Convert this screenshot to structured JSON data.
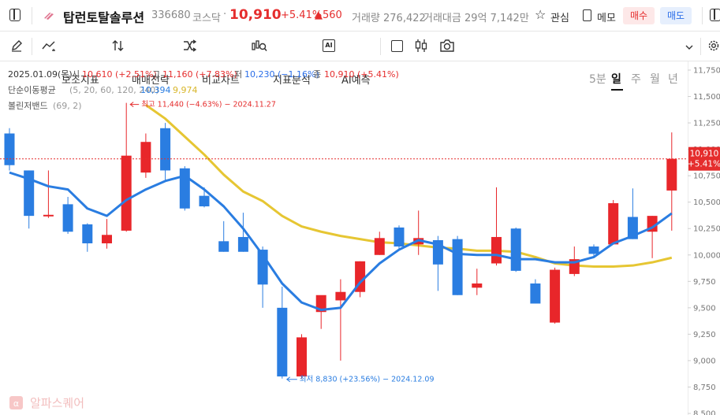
{
  "header": {
    "title": "탑런토탈솔루션",
    "code": "336680",
    "market": "코스닥",
    "dot": "·",
    "price": "10,910",
    "change_pct": "+5.41%",
    "change_amt": "▲560",
    "volume": "거래량 276,422",
    "amount": "거래대금 29억 7,142만",
    "watch_label": "관심",
    "memo_label": "메모",
    "buy_label": "매수",
    "sell_label": "매도"
  },
  "toolbar": {
    "indicator": "보조지표",
    "strategy": "매매전략",
    "compare": "비교차트",
    "analysis": "지표분석",
    "ai": "AI예측",
    "ai_badge": "AI",
    "periods": [
      "5분",
      "일",
      "주",
      "월",
      "년"
    ],
    "active_period": "일"
  },
  "legend": {
    "date": "2025.01.09(목)",
    "open_label": "시",
    "open": "10,610 (+2.51%)",
    "high_label": "고",
    "high": "11,160 (+7.83%)",
    "low_label": "저",
    "low": "10,230 (−1.16%)",
    "close_label": "종",
    "close": "10,910 (+5.41%)",
    "ma_label": "단순이동평균",
    "ma_params": "(5, 20, 60, 120, 240)",
    "ma5": "10,394",
    "ma20": "9,974",
    "bb_label": "볼린저밴드",
    "bb_params": "(69, 2)"
  },
  "annotations": {
    "max": "최고 11,440 (−4.63%) − 2024.11.27",
    "min": "최저 8,830 (+23.56%) − 2024.12.09"
  },
  "current_price_tag": {
    "price": "10,910",
    "pct": "+5.41%"
  },
  "watermark": "알파스퀘어",
  "colors": {
    "up": "#e8262a",
    "down": "#2a7de1",
    "ma5": "#2a7de1",
    "ma20": "#e6c633",
    "price_line": "#e52d2d"
  },
  "chart_data": {
    "type": "candlestick",
    "ylim": [
      8500,
      11750
    ],
    "y_ticks": [
      "11,750",
      "11,500",
      "11,250",
      "11,000",
      "10,750",
      "10,500",
      "10,250",
      "10,000",
      "9,750",
      "9,500",
      "9,250",
      "9,000",
      "8,750",
      "8,500"
    ],
    "candles": [
      {
        "o": 11150,
        "h": 11200,
        "l": 10800,
        "c": 10850
      },
      {
        "o": 10800,
        "h": 10800,
        "l": 10250,
        "c": 10370
      },
      {
        "o": 10370,
        "h": 10800,
        "l": 10350,
        "c": 10380
      },
      {
        "o": 10480,
        "h": 10550,
        "l": 10200,
        "c": 10220
      },
      {
        "o": 10290,
        "h": 10300,
        "l": 10030,
        "c": 10110
      },
      {
        "o": 10110,
        "h": 10340,
        "l": 10060,
        "c": 10190
      },
      {
        "o": 10230,
        "h": 11440,
        "l": 10220,
        "c": 10940
      },
      {
        "o": 10780,
        "h": 11150,
        "l": 10730,
        "c": 11070
      },
      {
        "o": 11200,
        "h": 11250,
        "l": 10700,
        "c": 10800
      },
      {
        "o": 10820,
        "h": 10840,
        "l": 10420,
        "c": 10440
      },
      {
        "o": 10560,
        "h": 10640,
        "l": 10450,
        "c": 10460
      },
      {
        "o": 10130,
        "h": 10320,
        "l": 10030,
        "c": 10030
      },
      {
        "o": 10170,
        "h": 10400,
        "l": 10030,
        "c": 10030
      },
      {
        "o": 10050,
        "h": 10080,
        "l": 9500,
        "c": 9720
      },
      {
        "o": 9500,
        "h": 9700,
        "l": 8830,
        "c": 8850
      },
      {
        "o": 8850,
        "h": 9250,
        "l": 8830,
        "c": 9220
      },
      {
        "o": 9460,
        "h": 9600,
        "l": 9300,
        "c": 9620
      },
      {
        "o": 9570,
        "h": 9770,
        "l": 9000,
        "c": 9650
      },
      {
        "o": 9650,
        "h": 9940,
        "l": 9600,
        "c": 9940
      },
      {
        "o": 10000,
        "h": 10220,
        "l": 10000,
        "c": 10160
      },
      {
        "o": 10260,
        "h": 10280,
        "l": 10060,
        "c": 10080
      },
      {
        "o": 10100,
        "h": 10420,
        "l": 10000,
        "c": 10160
      },
      {
        "o": 10140,
        "h": 10180,
        "l": 9660,
        "c": 9910
      },
      {
        "o": 10150,
        "h": 10180,
        "l": 9620,
        "c": 9620
      },
      {
        "o": 9690,
        "h": 9870,
        "l": 9620,
        "c": 9730
      },
      {
        "o": 9920,
        "h": 10640,
        "l": 9900,
        "c": 10170
      },
      {
        "o": 10250,
        "h": 10260,
        "l": 9840,
        "c": 9850
      },
      {
        "o": 9730,
        "h": 9770,
        "l": 9540,
        "c": 9540
      },
      {
        "o": 9360,
        "h": 9880,
        "l": 9350,
        "c": 9860
      },
      {
        "o": 9820,
        "h": 10080,
        "l": 9800,
        "c": 9960
      },
      {
        "o": 10080,
        "h": 10100,
        "l": 9990,
        "c": 10010
      },
      {
        "o": 10100,
        "h": 10520,
        "l": 10100,
        "c": 10490
      },
      {
        "o": 10360,
        "h": 10630,
        "l": 10150,
        "c": 10150
      },
      {
        "o": 10220,
        "h": 10370,
        "l": 9970,
        "c": 10370
      },
      {
        "o": 10610,
        "h": 11160,
        "l": 10230,
        "c": 10910
      }
    ],
    "ma5": [
      10780,
      10720,
      10650,
      10620,
      10440,
      10370,
      10520,
      10620,
      10700,
      10750,
      10620,
      10460,
      10250,
      10000,
      9730,
      9550,
      9480,
      9500,
      9740,
      9920,
      10050,
      10140,
      10100,
      10010,
      10000,
      10000,
      9960,
      9960,
      9930,
      9930,
      9980,
      10110,
      10180,
      10260,
      10394
    ],
    "ma20": [
      null,
      null,
      null,
      null,
      null,
      null,
      null,
      11420,
      11290,
      11120,
      10950,
      10760,
      10600,
      10510,
      10370,
      10270,
      10220,
      10180,
      10150,
      10120,
      10110,
      10090,
      10070,
      10060,
      10040,
      10040,
      10030,
      9980,
      9920,
      9900,
      9890,
      9890,
      9900,
      9930,
      9974
    ]
  }
}
